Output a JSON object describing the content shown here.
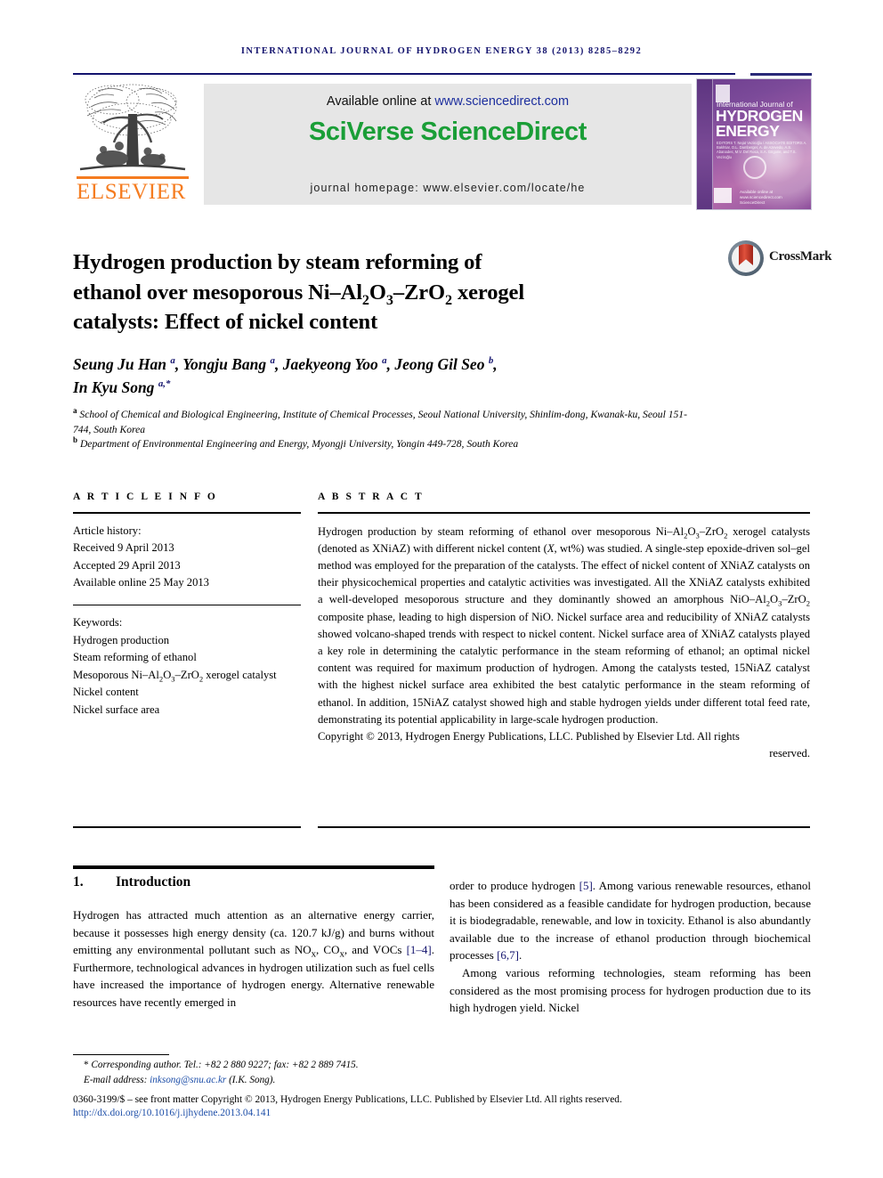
{
  "running_head": "International Journal of Hydrogen Energy 38 (2013) 8285–8292",
  "masthead": {
    "publisher_name": "ELSEVIER",
    "available_prefix": "Available online at ",
    "available_url": "www.sciencedirect.com",
    "sciencedirect_logo": "SciVerse ScienceDirect",
    "journal_homepage": "journal homepage: www.elsevier.com/locate/he",
    "cover": {
      "line1": "International Journal of",
      "line2": "HYDROGEN ENERGY",
      "editors": "EDITORS  T. Nejat Veziroğlu  /  ASSOCIATE EDITORS  A. Bakhtiar, D.L. Damberger, A. de Azevedo, A.S. Abanades, M.V. Del Rosa, S.A. Grigorie, and T.S. Veziroğlu",
      "science_direct_note": "Available online at www.sciencedirect.com  ScienceDirect"
    }
  },
  "crossmark": {
    "label": "CrossMark"
  },
  "article": {
    "title_line1": "Hydrogen production by steam reforming of",
    "title_line2_a": "ethanol over mesoporous Ni–Al",
    "title_line2_b": "O",
    "title_line2_c": "–ZrO",
    "title_line2_d": " xerogel",
    "title_line3": "catalysts: Effect of nickel content",
    "authors_line1": "Seung Ju Han a, Yongju Bang a, Jaekyeong Yoo a, Jeong Gil Seo b,",
    "authors_line2": "In Kyu Song a,*",
    "affiliation_a": "School of Chemical and Biological Engineering, Institute of Chemical Processes, Seoul National University, Shinlim-dong, Kwanak-ku, Seoul 151-744, South Korea",
    "affiliation_b": "Department of Environmental Engineering and Energy, Myongji University, Yongin 449-728, South Korea"
  },
  "article_info": {
    "heading": "A R T I C L E   I N F O",
    "history_label": "Article history:",
    "received": "Received 9 April 2013",
    "accepted": "Accepted 29 April 2013",
    "available_online": "Available online 25 May 2013",
    "keywords_label": "Keywords:",
    "keywords": [
      "Hydrogen production",
      "Steam reforming of ethanol",
      "Mesoporous Ni–Al2O3–ZrO2 xerogel catalyst",
      "Nickel content",
      "Nickel surface area"
    ]
  },
  "abstract": {
    "heading": "A B S T R A C T",
    "body": "Hydrogen production by steam reforming of ethanol over mesoporous Ni–Al2O3–ZrO2 xerogel catalysts (denoted as XNiAZ) with different nickel content (X, wt%) was studied. A single-step epoxide-driven sol–gel method was employed for the preparation of the catalysts. The effect of nickel content of XNiAZ catalysts on their physicochemical properties and catalytic activities was investigated. All the XNiAZ catalysts exhibited a well-developed mesoporous structure and they dominantly showed an amorphous NiO–Al2O3–ZrO2 composite phase, leading to high dispersion of NiO. Nickel surface area and reducibility of XNiAZ catalysts showed volcano-shaped trends with respect to nickel content. Nickel surface area of XNiAZ catalysts played a key role in determining the catalytic performance in the steam reforming of ethanol; an optimal nickel content was required for maximum production of hydrogen. Among the catalysts tested, 15NiAZ catalyst with the highest nickel surface area exhibited the best catalytic performance in the steam reforming of ethanol. In addition, 15NiAZ catalyst showed high and stable hydrogen yields under different total feed rate, demonstrating its potential applicability in large-scale hydrogen production.",
    "copyright_main": "Copyright © 2013, Hydrogen Energy Publications, LLC. Published by Elsevier Ltd. All rights",
    "copyright_last": "reserved."
  },
  "body": {
    "section_number": "1.",
    "section_title": "Introduction",
    "left_paragraph": "Hydrogen has attracted much attention as an alternative energy carrier, because it possesses high energy density (ca. 120.7 kJ/g) and burns without emitting any environmental pollutant such as NOx, COx, and VOCs [1–4]. Furthermore, technological advances in hydrogen utilization such as fuel cells have increased the importance of hydrogen energy. Alternative renewable resources have recently emerged in",
    "right_paragraph_1": "order to produce hydrogen [5]. Among various renewable resources, ethanol has been considered as a feasible candidate for hydrogen production, because it is biodegradable, renewable, and low in toxicity. Ethanol is also abundantly available due to the increase of ethanol production through biochemical processes [6,7].",
    "right_paragraph_2": "Among various reforming technologies, steam reforming has been considered as the most promising process for hydrogen production due to its high hydrogen yield. Nickel"
  },
  "footer": {
    "corresponding": "Corresponding author. Tel.: +82 2 880 9227; fax: +82 2 889 7415.",
    "email_label": "E-mail address: ",
    "email": "inksong@snu.ac.kr",
    "email_suffix": " (I.K. Song).",
    "issn_line": "0360-3199/$ – see front matter Copyright © 2013, Hydrogen Energy Publications, LLC. Published by Elsevier Ltd. All rights reserved.",
    "doi": "http://dx.doi.org/10.1016/j.ijhydene.2013.04.141"
  }
}
